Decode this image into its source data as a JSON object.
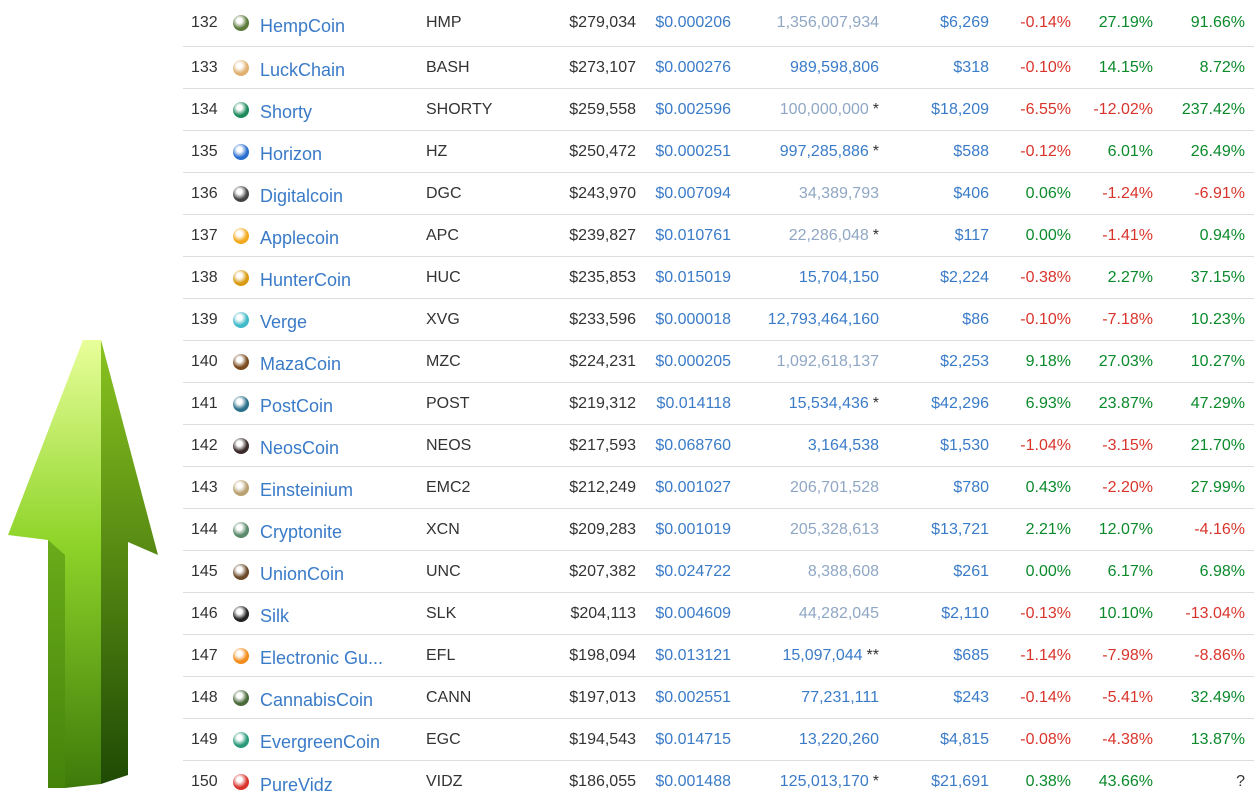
{
  "colors": {
    "link": "#3a7bc8",
    "positive": "#0a8a2a",
    "negative": "#d9342b",
    "arrow": "#7fbf1e"
  },
  "decor": {
    "arrow_icon": "green-up-arrow-icon"
  },
  "rows": [
    {
      "rank": "132",
      "name": "HempCoin",
      "symbol": "HMP",
      "market_cap": "$279,034",
      "price": "$0.000206",
      "supply": "1,356,007,934",
      "supply_mark": "",
      "volume": "$6,269",
      "ch1h": "-0.14%",
      "ch24h": "27.19%",
      "ch7d": "91.66%",
      "icon_color": "#5c7a3a"
    },
    {
      "rank": "133",
      "name": "LuckChain",
      "symbol": "BASH",
      "market_cap": "$273,107",
      "price": "$0.000276",
      "supply": "989,598,806",
      "supply_mark": "",
      "volume": "$318",
      "ch1h": "-0.10%",
      "ch24h": "14.15%",
      "ch7d": "8.72%",
      "icon_color": "#e0b070"
    },
    {
      "rank": "134",
      "name": "Shorty",
      "symbol": "SHORTY",
      "market_cap": "$259,558",
      "price": "$0.002596",
      "supply": "100,000,000",
      "supply_mark": "*",
      "volume": "$18,209",
      "ch1h": "-6.55%",
      "ch24h": "-12.02%",
      "ch7d": "237.42%",
      "icon_color": "#1d8a5c"
    },
    {
      "rank": "135",
      "name": "Horizon",
      "symbol": "HZ",
      "market_cap": "$250,472",
      "price": "$0.000251",
      "supply": "997,285,886",
      "supply_mark": "*",
      "volume": "$588",
      "ch1h": "-0.12%",
      "ch24h": "6.01%",
      "ch7d": "26.49%",
      "icon_color": "#2a6fcf"
    },
    {
      "rank": "136",
      "name": "Digitalcoin",
      "symbol": "DGC",
      "market_cap": "$243,970",
      "price": "$0.007094",
      "supply": "34,389,793",
      "supply_mark": "",
      "volume": "$406",
      "ch1h": "0.06%",
      "ch24h": "-1.24%",
      "ch7d": "-6.91%",
      "icon_color": "#444444"
    },
    {
      "rank": "137",
      "name": "Applecoin",
      "symbol": "APC",
      "market_cap": "$239,827",
      "price": "$0.010761",
      "supply": "22,286,048",
      "supply_mark": "*",
      "volume": "$117",
      "ch1h": "0.00%",
      "ch24h": "-1.41%",
      "ch7d": "0.94%",
      "icon_color": "#f2a91c"
    },
    {
      "rank": "138",
      "name": "HunterCoin",
      "symbol": "HUC",
      "market_cap": "$235,853",
      "price": "$0.015019",
      "supply": "15,704,150",
      "supply_mark": "",
      "volume": "$2,224",
      "ch1h": "-0.38%",
      "ch24h": "2.27%",
      "ch7d": "37.15%",
      "icon_color": "#d89a10"
    },
    {
      "rank": "139",
      "name": "Verge",
      "symbol": "XVG",
      "market_cap": "$233,596",
      "price": "$0.000018",
      "supply": "12,793,464,160",
      "supply_mark": "",
      "volume": "$86",
      "ch1h": "-0.10%",
      "ch24h": "-7.18%",
      "ch7d": "10.23%",
      "icon_color": "#3fb9c8"
    },
    {
      "rank": "140",
      "name": "MazaCoin",
      "symbol": "MZC",
      "market_cap": "$224,231",
      "price": "$0.000205",
      "supply": "1,092,618,137",
      "supply_mark": "",
      "volume": "$2,253",
      "ch1h": "9.18%",
      "ch24h": "27.03%",
      "ch7d": "10.27%",
      "icon_color": "#7a4a1e"
    },
    {
      "rank": "141",
      "name": "PostCoin",
      "symbol": "POST",
      "market_cap": "$219,312",
      "price": "$0.014118",
      "supply": "15,534,436",
      "supply_mark": "*",
      "volume": "$42,296",
      "ch1h": "6.93%",
      "ch24h": "23.87%",
      "ch7d": "47.29%",
      "icon_color": "#2b6f8a"
    },
    {
      "rank": "142",
      "name": "NeosCoin",
      "symbol": "NEOS",
      "market_cap": "$217,593",
      "price": "$0.068760",
      "supply": "3,164,538",
      "supply_mark": "",
      "volume": "$1,530",
      "ch1h": "-1.04%",
      "ch24h": "-3.15%",
      "ch7d": "21.70%",
      "icon_color": "#3a2a2a"
    },
    {
      "rank": "143",
      "name": "Einsteinium",
      "symbol": "EMC2",
      "market_cap": "$212,249",
      "price": "$0.001027",
      "supply": "206,701,528",
      "supply_mark": "",
      "volume": "$780",
      "ch1h": "0.43%",
      "ch24h": "-2.20%",
      "ch7d": "27.99%",
      "icon_color": "#b8a070"
    },
    {
      "rank": "144",
      "name": "Cryptonite",
      "symbol": "XCN",
      "market_cap": "$209,283",
      "price": "$0.001019",
      "supply": "205,328,613",
      "supply_mark": "",
      "volume": "$13,721",
      "ch1h": "2.21%",
      "ch24h": "12.07%",
      "ch7d": "-4.16%",
      "icon_color": "#5a8a6a"
    },
    {
      "rank": "145",
      "name": "UnionCoin",
      "symbol": "UNC",
      "market_cap": "$207,382",
      "price": "$0.024722",
      "supply": "8,388,608",
      "supply_mark": "",
      "volume": "$261",
      "ch1h": "0.00%",
      "ch24h": "6.17%",
      "ch7d": "6.98%",
      "icon_color": "#6a4a2a"
    },
    {
      "rank": "146",
      "name": "Silk",
      "symbol": "SLK",
      "market_cap": "$204,113",
      "price": "$0.004609",
      "supply": "44,282,045",
      "supply_mark": "",
      "volume": "$2,110",
      "ch1h": "-0.13%",
      "ch24h": "10.10%",
      "ch7d": "-13.04%",
      "icon_color": "#222222"
    },
    {
      "rank": "147",
      "name": "Electronic Gu...",
      "symbol": "EFL",
      "market_cap": "$198,094",
      "price": "$0.013121",
      "supply": "15,097,044",
      "supply_mark": "**",
      "volume": "$685",
      "ch1h": "-1.14%",
      "ch24h": "-7.98%",
      "ch7d": "-8.86%",
      "icon_color": "#f28c1c"
    },
    {
      "rank": "148",
      "name": "CannabisCoin",
      "symbol": "CANN",
      "market_cap": "$197,013",
      "price": "$0.002551",
      "supply": "77,231,111",
      "supply_mark": "",
      "volume": "$243",
      "ch1h": "-0.14%",
      "ch24h": "-5.41%",
      "ch7d": "32.49%",
      "icon_color": "#4a6a3a"
    },
    {
      "rank": "149",
      "name": "EvergreenCoin",
      "symbol": "EGC",
      "market_cap": "$194,543",
      "price": "$0.014715",
      "supply": "13,220,260",
      "supply_mark": "",
      "volume": "$4,815",
      "ch1h": "-0.08%",
      "ch24h": "-4.38%",
      "ch7d": "13.87%",
      "icon_color": "#2a9a7a"
    },
    {
      "rank": "150",
      "name": "PureVidz",
      "symbol": "VIDZ",
      "market_cap": "$186,055",
      "price": "$0.001488",
      "supply": "125,013,170",
      "supply_mark": "*",
      "volume": "$21,691",
      "ch1h": "0.38%",
      "ch24h": "43.66%",
      "ch7d": "?",
      "icon_color": "#d9342b"
    }
  ]
}
